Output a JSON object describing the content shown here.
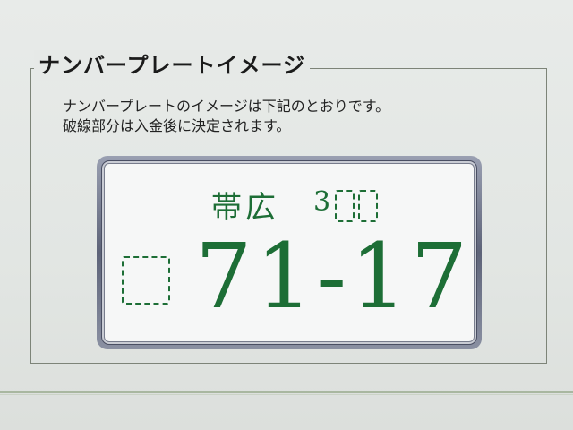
{
  "section": {
    "title": "ナンバープレートイメージ",
    "description_line1": "ナンバープレートのイメージは下記のとおりです。",
    "description_line2": "破線部分は入金後に決定されます。"
  },
  "plate": {
    "region": "帯広",
    "class_digit": "3",
    "number": "71-17",
    "text_color": "#1d6e36",
    "placeholder_shape": "dashed-square"
  }
}
